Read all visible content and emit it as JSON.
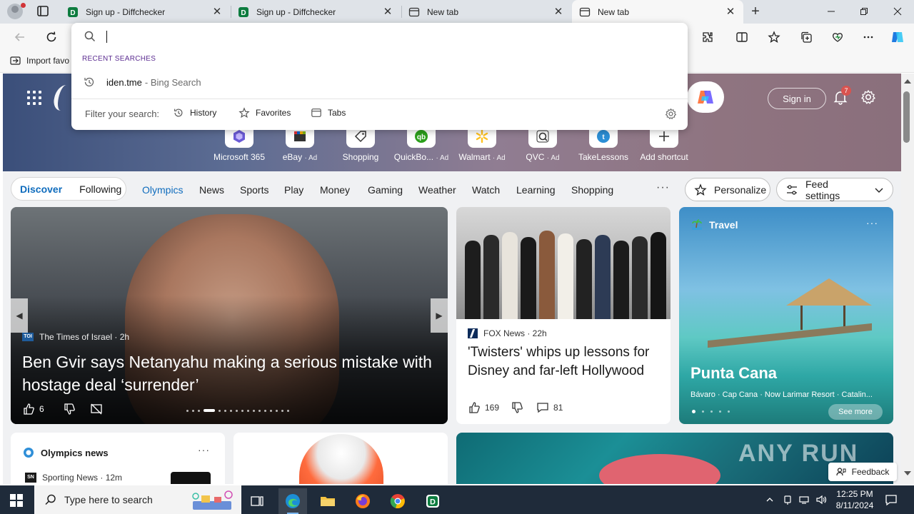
{
  "browser": {
    "tabs": [
      {
        "title": "Sign up - Diffchecker",
        "icon": "diffchecker-icon"
      },
      {
        "title": "Sign up - Diffchecker",
        "icon": "diffchecker-icon"
      },
      {
        "title": "New tab",
        "icon": "newtab-icon"
      },
      {
        "title": "New tab",
        "icon": "newtab-icon",
        "active": true
      }
    ],
    "window_controls": [
      "minimize-icon",
      "restore-icon",
      "close-icon"
    ]
  },
  "bookmarks": {
    "import_label": "Import favo"
  },
  "omnibox": {
    "query": "",
    "recent_header": "RECENT SEARCHES",
    "recent": [
      {
        "query": "iden.tme",
        "source": "- Bing Search"
      }
    ],
    "filter_label": "Filter your search:",
    "filters": [
      "History",
      "Favorites",
      "Tabs"
    ]
  },
  "page": {
    "sign_in": "Sign in",
    "notification_count": "7",
    "shortcuts": [
      {
        "label": "Microsoft 365",
        "ad": ""
      },
      {
        "label": "eBay",
        "ad": "· Ad"
      },
      {
        "label": "Shopping",
        "ad": ""
      },
      {
        "label": "QuickBo...",
        "ad": "· Ad"
      },
      {
        "label": "Walmart",
        "ad": "· Ad"
      },
      {
        "label": "QVC",
        "ad": "· Ad"
      },
      {
        "label": "TakeLessons",
        "ad": ""
      },
      {
        "label": "Add shortcut",
        "ad": ""
      }
    ],
    "nav": {
      "discover": "Discover",
      "following": "Following",
      "links": [
        "Olympics",
        "News",
        "Sports",
        "Play",
        "Money",
        "Gaming",
        "Weather",
        "Watch",
        "Learning",
        "Shopping"
      ],
      "active_link": "Olympics",
      "more": "···",
      "personalize": "Personalize",
      "feed_settings": "Feed settings"
    },
    "main_story": {
      "source_logo": "TOI",
      "source": "The Times of Israel · 2h",
      "title": "Ben Gvir says Netanyahu making a serious mistake with hostage deal ‘surrender’",
      "likes": "6"
    },
    "news_story": {
      "source": "FOX News · 22h",
      "title": "'Twisters' whips up lessons for Disney and far-left Hollywood",
      "likes": "169",
      "comments": "81"
    },
    "travel": {
      "section": "Travel",
      "title": "Punta Cana",
      "subtitle": "Bávaro · Cap Cana · Now Larimar Resort · Catalin...",
      "see_more": "See more"
    },
    "olympics": {
      "title": "Olympics news",
      "source_logo": "SN",
      "item_source": "Sporting News · 12m"
    },
    "watermark": "ANY RUN",
    "feedback": "Feedback"
  },
  "taskbar": {
    "search_placeholder": "Type here to search",
    "time": "12:25 PM",
    "date": "8/11/2024",
    "apps": [
      "task-view-icon",
      "edge-icon",
      "file-explorer-icon",
      "firefox-icon",
      "chrome-icon",
      "diffchecker-app-icon"
    ]
  },
  "colors": {
    "accent": "#0f6cbd",
    "recent_header": "#5c2d91",
    "taskbar": "#1f2b3a"
  }
}
